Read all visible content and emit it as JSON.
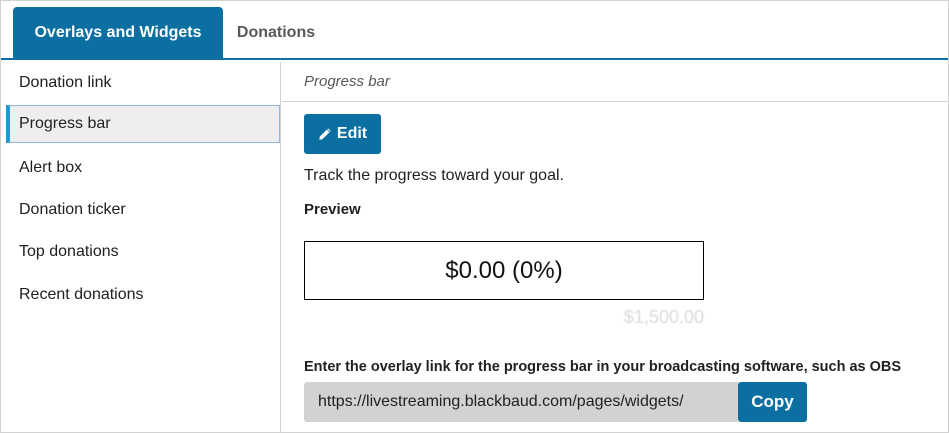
{
  "tabs": [
    {
      "label": "Overlays and Widgets",
      "active": true
    },
    {
      "label": "Donations",
      "active": false
    }
  ],
  "sidebar": {
    "items": [
      {
        "label": "Donation link",
        "active": false
      },
      {
        "label": "Progress bar",
        "active": true
      },
      {
        "label": "Alert box",
        "active": false
      },
      {
        "label": "Donation ticker",
        "active": false
      },
      {
        "label": "Top donations",
        "active": false
      },
      {
        "label": "Recent donations",
        "active": false
      }
    ]
  },
  "main": {
    "section_title": "Progress bar",
    "edit_label": "Edit",
    "edit_icon": "pencil-icon",
    "description": "Track the progress toward your goal.",
    "preview_label": "Preview",
    "progress_text": "$0.00 (0%)",
    "progress_percent": 0,
    "goal_text": "$1,500.00",
    "overlay_label": "Enter the overlay link for the progress bar in your broadcasting software, such as OBS",
    "overlay_url": "https://livestreaming.blackbaud.com/pages/widgets/",
    "copy_label": "Copy"
  },
  "colors": {
    "accent": "#0b6fa1",
    "sidebar_active_bar": "#1a9ad6",
    "field_bg": "#d2d2d2"
  }
}
